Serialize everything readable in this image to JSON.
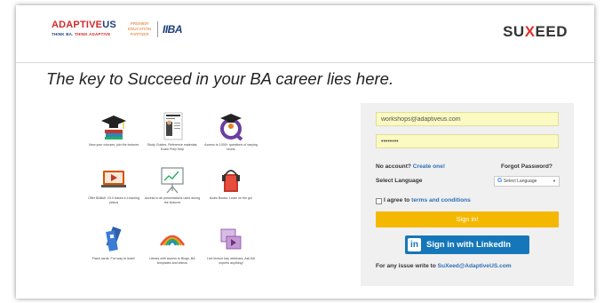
{
  "brand": {
    "name_a": "ADAPTIVE",
    "name_b": "US",
    "tag_a": "THINK BA.",
    "tag_b": "THINK ADAPTIVE",
    "partner_line1": "PREMIER",
    "partner_line2": "EDUCATION",
    "partner_line3": "PARTNER",
    "iiba": "IIBA",
    "suxeed_a": "SU",
    "suxeed_x": "X",
    "suxeed_b": "EED"
  },
  "headline": "The key to Succeed in your BA career lies here.",
  "features": [
    {
      "icon": "graduation-cap-books-icon",
      "caption": "View your courses, join the lectures"
    },
    {
      "icon": "study-guide-document-icon",
      "caption": "Study Guides, Reference materials, Exam Prep Help"
    },
    {
      "icon": "quiz-q-icon",
      "caption": "Access to 1000+ questions of varying levels"
    },
    {
      "icon": "video-laptop-icon",
      "caption": "Offer BABoK V3.0 based e-Learning videos"
    },
    {
      "icon": "presentation-board-icon",
      "caption": "Access to all presentations used during the lectures"
    },
    {
      "icon": "audiobook-icon",
      "caption": "Audio Books, Learn on the go!"
    },
    {
      "icon": "flash-cards-icon",
      "caption": "Flash cards, Fun way to learn!"
    },
    {
      "icon": "library-rainbow-icon",
      "caption": "Library with access to Blogs, BA templates and videos"
    },
    {
      "icon": "webinar-video-icon",
      "caption": "Live lecture bay webinars, Ask BA experts anything!"
    }
  ],
  "login": {
    "email_value": "workshops@adaptiveus.com",
    "password_value": "••••••••",
    "no_account": "No account?",
    "create_link": "Create one!",
    "forgot": "Forgot Password?",
    "select_language": "Select Language",
    "translate_g": "G",
    "translate_label": "Select Language",
    "translate_arrow": "▼",
    "agree_prefix": "I agree to",
    "terms_link": "terms and conditions",
    "signin_label": "Sign in!",
    "linkedin_in": "in",
    "linkedin_label": "Sign in with LinkedIn",
    "footer_prefix": "For any issue write to",
    "footer_email": "SuXeed@AdaptiveUS.com"
  },
  "colors": {
    "brand_red": "#d42a2a",
    "brand_blue": "#1d3f7a",
    "signin_yellow": "#f5b800",
    "linkedin_blue": "#1577b9",
    "field_yellow": "#fafac2"
  }
}
